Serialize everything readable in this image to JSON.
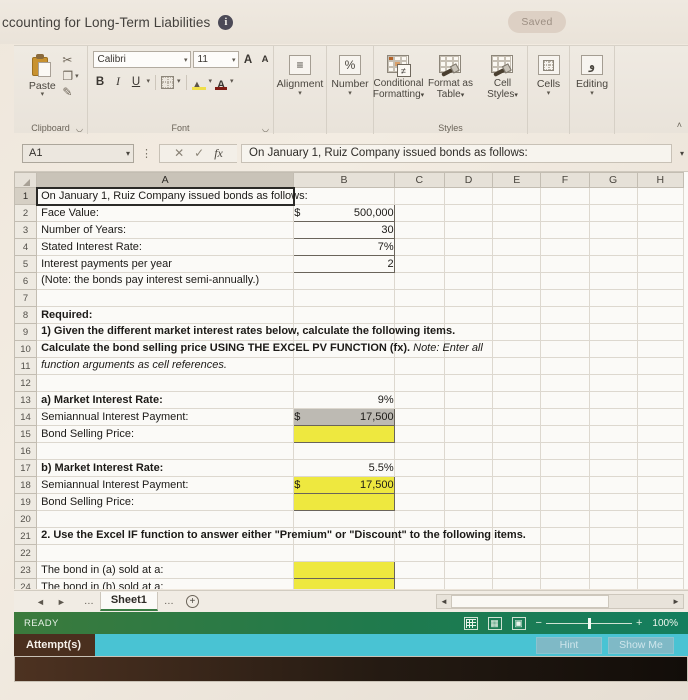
{
  "window": {
    "title": "ccounting for Long-Term Liabilities",
    "info_icon": "i",
    "saved_badge": "Saved"
  },
  "ribbon": {
    "clipboard": {
      "group_label": "Clipboard",
      "paste_label": "Paste",
      "cut_icon": "✂",
      "copy_icon": "❐",
      "format_painter_icon": "✎",
      "caret": "▾"
    },
    "font": {
      "group_label": "Font",
      "font_name": "Calibri",
      "font_size": "11",
      "grow_font": "A",
      "shrink_font": "A",
      "bold": "B",
      "italic": "I",
      "underline": "U",
      "caret": "▾"
    },
    "alignment": {
      "label": "Alignment",
      "icon": "≡",
      "caret": "▾"
    },
    "number": {
      "label": "Number",
      "icon": "%",
      "caret": "▾"
    },
    "styles": {
      "group_label": "Styles",
      "items": [
        {
          "line1": "Conditional",
          "line2": "Formatting"
        },
        {
          "line1": "Format as",
          "line2": "Table"
        },
        {
          "line1": "Cell",
          "line2": "Styles"
        }
      ],
      "badge": "≠"
    },
    "cells": {
      "label": "Cells",
      "caret": "▾"
    },
    "editing": {
      "label": "Editing",
      "icon": "و",
      "caret": "▾"
    },
    "collapse_caret": "˄"
  },
  "formula_bar": {
    "name_box": "A1",
    "name_caret": "▾",
    "dots": "⋮",
    "cancel": "✕",
    "enter": "✓",
    "insert_function": "fx",
    "formula": "On January 1,  Ruiz Company issued bonds as follows:",
    "expand_caret": "▾"
  },
  "grid": {
    "columns": [
      "A",
      "B",
      "C",
      "D",
      "E",
      "F",
      "G",
      "H"
    ],
    "selected_column": "A",
    "rows": [
      {
        "n": "1",
        "a": "On January 1,  Ruiz Company issued bonds as follows:",
        "a_bold": false,
        "a_active": true,
        "overflow": true,
        "b": "",
        "style": ""
      },
      {
        "n": "2",
        "a": "Face Value:",
        "b_currency": "$",
        "b": "500,000",
        "style": "boxed"
      },
      {
        "n": "3",
        "a": "Number of Years:",
        "b": "30",
        "style": "boxed"
      },
      {
        "n": "4",
        "a": "Stated Interest Rate:",
        "b": "7%",
        "style": "boxed"
      },
      {
        "n": "5",
        "a": "Interest payments per year",
        "b": "2",
        "style": "boxed"
      },
      {
        "n": "6",
        "a": "(Note: the bonds pay interest semi-annually.)",
        "b": "",
        "overflow": true,
        "style": ""
      },
      {
        "n": "7",
        "a": "",
        "b": "",
        "style": ""
      },
      {
        "n": "8",
        "a": "Required:",
        "a_bold": true,
        "b": "",
        "style": ""
      },
      {
        "n": "9",
        "a": " 1) Given the different market interest rates below, calculate the following items.",
        "a_bold": true,
        "overflow": true,
        "b": "",
        "style": ""
      },
      {
        "n": "10",
        "a": "Calculate the bond selling price USING THE EXCEL PV FUNCTION (fx).",
        "a_bold": true,
        "a_tail_italic": " Note: Enter all",
        "overflow": true,
        "b": "",
        "style": ""
      },
      {
        "n": "11",
        "a": "function arguments as cell references.",
        "a_italic": true,
        "overflow": true,
        "b": "",
        "style": ""
      },
      {
        "n": "12",
        "a": "",
        "b": "",
        "style": ""
      },
      {
        "n": "13",
        "a": "a)  Market Interest Rate:",
        "a_bold": true,
        "b": "9%",
        "style": ""
      },
      {
        "n": "14",
        "a": "      Semiannual Interest Payment:",
        "b_currency": "$",
        "b": "17,500",
        "style": "boxed gray"
      },
      {
        "n": "15",
        "a": "      Bond Selling Price:",
        "b": "",
        "style": "boxed yellow"
      },
      {
        "n": "16",
        "a": "",
        "b": "",
        "style": ""
      },
      {
        "n": "17",
        "a": "b)  Market Interest Rate:",
        "a_bold": true,
        "b": "5.5%",
        "style": ""
      },
      {
        "n": "18",
        "a": "      Semiannual Interest Payment:",
        "b_currency": "$",
        "b": "17,500",
        "style": "boxed yellow"
      },
      {
        "n": "19",
        "a": "      Bond Selling Price:",
        "b": "",
        "style": "boxed yellow"
      },
      {
        "n": "20",
        "a": "",
        "b": "",
        "style": ""
      },
      {
        "n": "21",
        "a": "2. Use the Excel IF function to answer either \"Premium\" or \"Discount\" to the following items.",
        "a_bold": true,
        "overflow": true,
        "b": "",
        "style": ""
      },
      {
        "n": "22",
        "a": "",
        "b": "",
        "style": ""
      },
      {
        "n": "23",
        "a": "The bond in (a) sold at a:",
        "b": "",
        "style": "boxed yellow"
      },
      {
        "n": "24",
        "a": "The bond in (b) sold at a:",
        "b": "",
        "style": "boxed yellow"
      }
    ]
  },
  "tabstrip": {
    "first_arrow": "◄",
    "last_arrow": "►",
    "dots_left": "…",
    "sheet_name": "Sheet1",
    "dots_right": "…",
    "add_sheet": "+",
    "scroll_left": "◄",
    "scroll_right": "►"
  },
  "status_bar": {
    "mode": "READY",
    "view_normal": "normal-view",
    "view_page_layout": "page-layout-view",
    "view_page_break": "page-break-view",
    "zoom_minus": "−",
    "zoom_plus": "+",
    "zoom_level": "100%"
  },
  "attempts": {
    "label": "Attempt(s)",
    "hint_button": "Hint",
    "show_me_button": "Show Me"
  },
  "colors": {
    "accent_green": "#1f7a4d",
    "teal": "#49c3d3",
    "yellow_cell": "#eee83f",
    "gray_cell": "#bdbab3",
    "attempt_tab": "#4a2f1e"
  }
}
